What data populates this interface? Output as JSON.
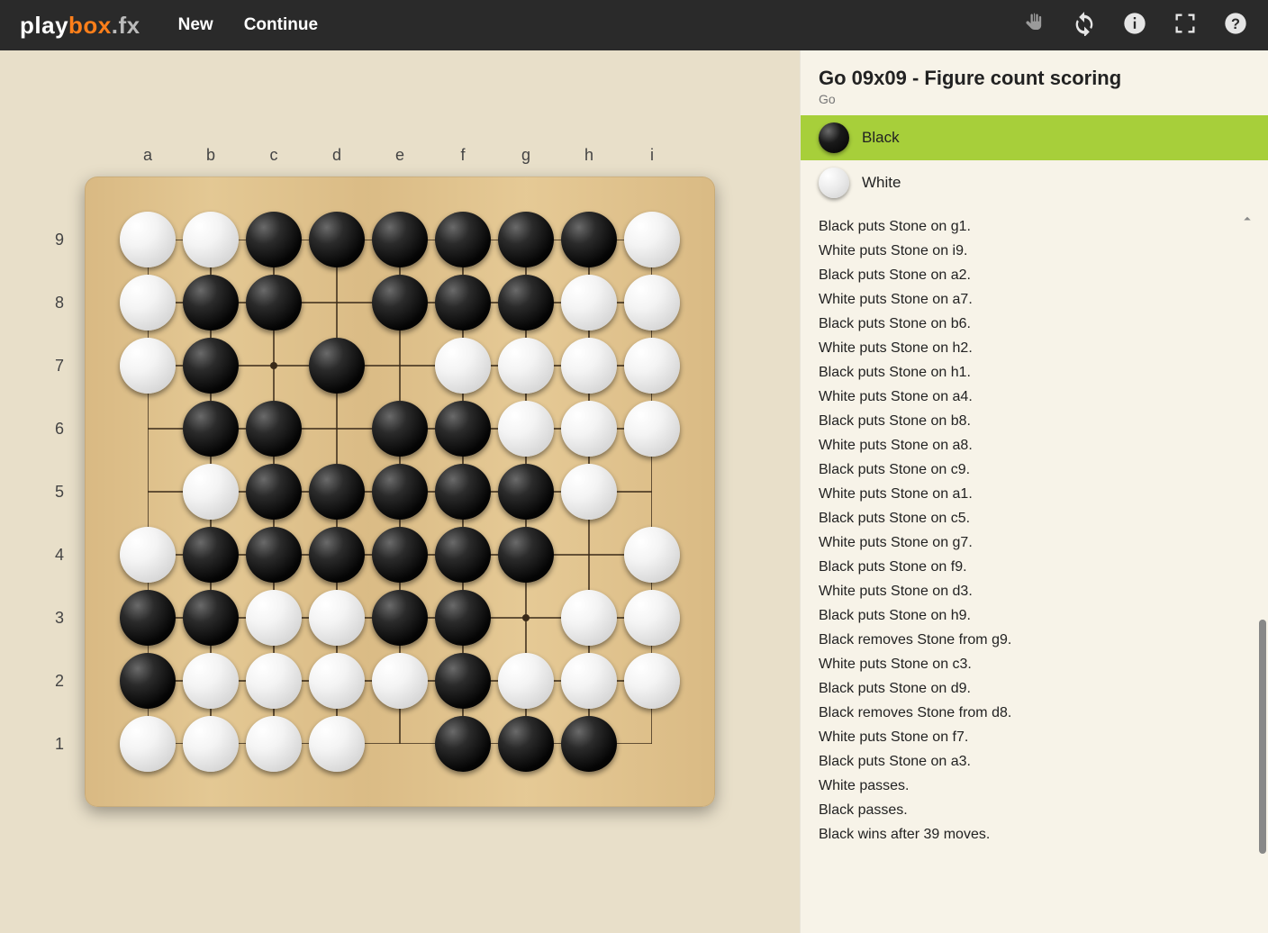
{
  "brand": {
    "part1": "play",
    "part2": "box",
    "part3": ".fx"
  },
  "nav": {
    "new": "New",
    "continue": "Continue"
  },
  "title": "Go 09x09 - Figure count scoring",
  "subtitle": "Go",
  "players": {
    "black": "Black",
    "white": "White",
    "active": "black"
  },
  "board": {
    "cols": [
      "a",
      "b",
      "c",
      "d",
      "e",
      "f",
      "g",
      "h",
      "i"
    ],
    "rows": [
      "9",
      "8",
      "7",
      "6",
      "5",
      "4",
      "3",
      "2",
      "1"
    ],
    "stars": [
      [
        3,
        3
      ],
      [
        3,
        7
      ],
      [
        7,
        3
      ],
      [
        7,
        7
      ],
      [
        5,
        5
      ]
    ],
    "stones": [
      {
        "c": 1,
        "r": 9,
        "k": "W"
      },
      {
        "c": 2,
        "r": 9,
        "k": "W"
      },
      {
        "c": 3,
        "r": 9,
        "k": "B"
      },
      {
        "c": 4,
        "r": 9,
        "k": "B"
      },
      {
        "c": 5,
        "r": 9,
        "k": "B"
      },
      {
        "c": 6,
        "r": 9,
        "k": "B"
      },
      {
        "c": 7,
        "r": 9,
        "k": "B"
      },
      {
        "c": 8,
        "r": 9,
        "k": "B"
      },
      {
        "c": 9,
        "r": 9,
        "k": "W"
      },
      {
        "c": 1,
        "r": 8,
        "k": "W"
      },
      {
        "c": 2,
        "r": 8,
        "k": "B"
      },
      {
        "c": 3,
        "r": 8,
        "k": "B"
      },
      {
        "c": 5,
        "r": 8,
        "k": "B"
      },
      {
        "c": 6,
        "r": 8,
        "k": "B"
      },
      {
        "c": 7,
        "r": 8,
        "k": "B"
      },
      {
        "c": 8,
        "r": 8,
        "k": "W"
      },
      {
        "c": 9,
        "r": 8,
        "k": "W"
      },
      {
        "c": 1,
        "r": 7,
        "k": "W"
      },
      {
        "c": 2,
        "r": 7,
        "k": "B"
      },
      {
        "c": 4,
        "r": 7,
        "k": "B"
      },
      {
        "c": 6,
        "r": 7,
        "k": "W"
      },
      {
        "c": 7,
        "r": 7,
        "k": "W"
      },
      {
        "c": 8,
        "r": 7,
        "k": "W"
      },
      {
        "c": 9,
        "r": 7,
        "k": "W"
      },
      {
        "c": 2,
        "r": 6,
        "k": "B"
      },
      {
        "c": 3,
        "r": 6,
        "k": "B"
      },
      {
        "c": 5,
        "r": 6,
        "k": "B"
      },
      {
        "c": 6,
        "r": 6,
        "k": "B"
      },
      {
        "c": 7,
        "r": 6,
        "k": "W"
      },
      {
        "c": 8,
        "r": 6,
        "k": "W"
      },
      {
        "c": 9,
        "r": 6,
        "k": "W"
      },
      {
        "c": 2,
        "r": 5,
        "k": "W"
      },
      {
        "c": 3,
        "r": 5,
        "k": "B"
      },
      {
        "c": 4,
        "r": 5,
        "k": "B"
      },
      {
        "c": 5,
        "r": 5,
        "k": "B"
      },
      {
        "c": 6,
        "r": 5,
        "k": "B"
      },
      {
        "c": 7,
        "r": 5,
        "k": "B"
      },
      {
        "c": 8,
        "r": 5,
        "k": "W"
      },
      {
        "c": 1,
        "r": 4,
        "k": "W"
      },
      {
        "c": 2,
        "r": 4,
        "k": "B"
      },
      {
        "c": 3,
        "r": 4,
        "k": "B"
      },
      {
        "c": 4,
        "r": 4,
        "k": "B"
      },
      {
        "c": 5,
        "r": 4,
        "k": "B"
      },
      {
        "c": 6,
        "r": 4,
        "k": "B"
      },
      {
        "c": 7,
        "r": 4,
        "k": "B"
      },
      {
        "c": 9,
        "r": 4,
        "k": "W"
      },
      {
        "c": 1,
        "r": 3,
        "k": "B"
      },
      {
        "c": 2,
        "r": 3,
        "k": "B"
      },
      {
        "c": 3,
        "r": 3,
        "k": "W"
      },
      {
        "c": 4,
        "r": 3,
        "k": "W"
      },
      {
        "c": 5,
        "r": 3,
        "k": "B"
      },
      {
        "c": 6,
        "r": 3,
        "k": "B"
      },
      {
        "c": 8,
        "r": 3,
        "k": "W"
      },
      {
        "c": 9,
        "r": 3,
        "k": "W"
      },
      {
        "c": 1,
        "r": 2,
        "k": "B"
      },
      {
        "c": 2,
        "r": 2,
        "k": "W"
      },
      {
        "c": 3,
        "r": 2,
        "k": "W"
      },
      {
        "c": 4,
        "r": 2,
        "k": "W"
      },
      {
        "c": 5,
        "r": 2,
        "k": "W"
      },
      {
        "c": 6,
        "r": 2,
        "k": "B"
      },
      {
        "c": 7,
        "r": 2,
        "k": "W"
      },
      {
        "c": 8,
        "r": 2,
        "k": "W"
      },
      {
        "c": 9,
        "r": 2,
        "k": "W"
      },
      {
        "c": 1,
        "r": 1,
        "k": "W"
      },
      {
        "c": 2,
        "r": 1,
        "k": "W"
      },
      {
        "c": 3,
        "r": 1,
        "k": "W"
      },
      {
        "c": 4,
        "r": 1,
        "k": "W"
      },
      {
        "c": 6,
        "r": 1,
        "k": "B"
      },
      {
        "c": 7,
        "r": 1,
        "k": "B"
      },
      {
        "c": 8,
        "r": 1,
        "k": "B"
      }
    ]
  },
  "log": [
    "Black puts Stone on g1.",
    "White puts Stone on i9.",
    "Black puts Stone on a2.",
    "White puts Stone on a7.",
    "Black puts Stone on b6.",
    "White puts Stone on h2.",
    "Black puts Stone on h1.",
    "White puts Stone on a4.",
    "Black puts Stone on b8.",
    "White puts Stone on a8.",
    "Black puts Stone on c9.",
    "White puts Stone on a1.",
    "Black puts Stone on c5.",
    "White puts Stone on g7.",
    "Black puts Stone on f9.",
    "White puts Stone on d3.",
    "Black puts Stone on h9.",
    "Black removes Stone from g9.",
    "White puts Stone on c3.",
    "Black puts Stone on d9.",
    "Black removes Stone from d8.",
    "White puts Stone on f7.",
    "Black puts Stone on a3.",
    "White passes.",
    "Black passes.",
    "Black wins after 39 moves."
  ]
}
